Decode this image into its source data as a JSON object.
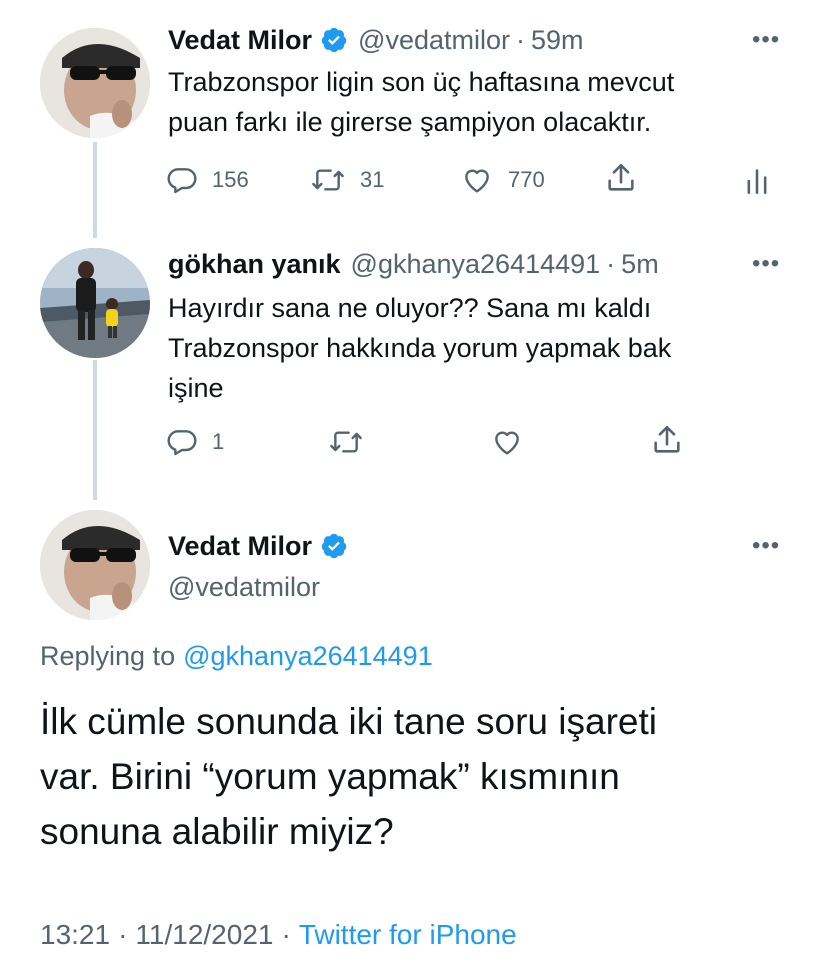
{
  "tweet1": {
    "name": "Vedat Milor",
    "handle": "@vedatmilor",
    "sep": "·",
    "time": "59m",
    "text_line1": "Trabzonspor ligin son üç haftasına mevcut",
    "text_line2": "puan farkı ile girerse şampiyon olacaktır.",
    "replies": "156",
    "retweets": "31",
    "likes": "770"
  },
  "tweet2": {
    "name": "gökhan yanık",
    "handle": "@gkhanya26414491",
    "sep": "·",
    "time": "5m",
    "text_line1": "Hayırdır sana ne oluyor?? Sana mı kaldı",
    "text_line2": "Trabzonspor hakkında yorum yapmak bak",
    "text_line3": "işine",
    "replies": "1"
  },
  "tweet3": {
    "name": "Vedat Milor",
    "handle": "@vedatmilor",
    "replying_prefix": "Replying to",
    "replying_to": "@gkhanya26414491",
    "text_line1": "İlk cümle sonunda iki tane soru işareti",
    "text_line2": "var. Birini “yorum yapmak” kısmının",
    "text_line3": "sonuna alabilir miyiz?",
    "time": "13:21",
    "sep1": "·",
    "date": "11/12/2021",
    "sep2": "·",
    "source": "Twitter for iPhone"
  },
  "more_label": "•••",
  "colors": {
    "accent": "#1d9bf0",
    "muted": "#536471",
    "text": "#0f1419",
    "line": "#cfd9de"
  },
  "icons": [
    "verified-badge-icon",
    "reply-icon",
    "retweet-icon",
    "like-icon",
    "share-icon",
    "analytics-icon",
    "more-icon"
  ]
}
